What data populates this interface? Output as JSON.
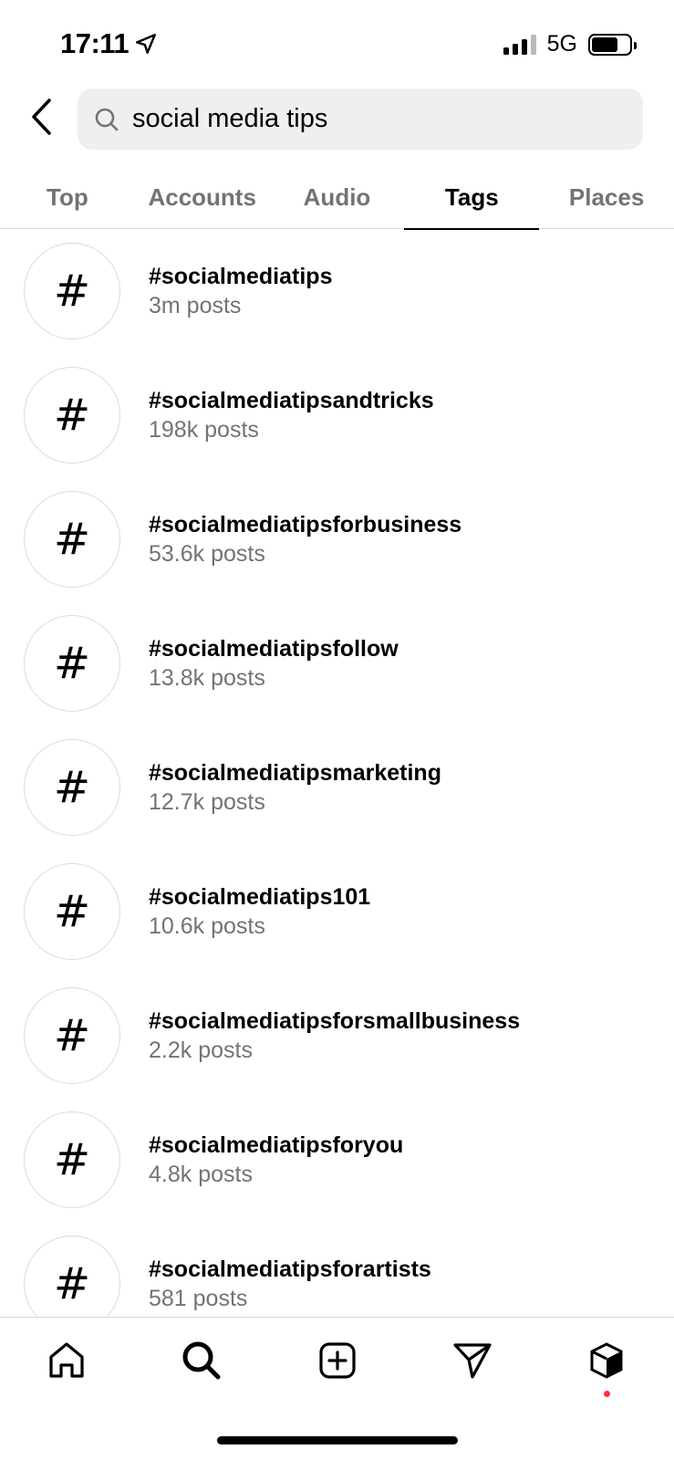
{
  "status_bar": {
    "time": "17:11",
    "network": "5G",
    "location_icon": "location-arrow-icon",
    "signal_bars_active": 3,
    "signal_bars_total": 4,
    "battery_level": 0.7
  },
  "header": {
    "back_icon": "chevron-left-icon",
    "search": {
      "icon": "search-icon",
      "value": "social media tips",
      "placeholder": "Search"
    }
  },
  "tabs": [
    {
      "label": "Top",
      "active": false
    },
    {
      "label": "Accounts",
      "active": false
    },
    {
      "label": "Audio",
      "active": false
    },
    {
      "label": "Tags",
      "active": true
    },
    {
      "label": "Places",
      "active": false
    }
  ],
  "results": [
    {
      "icon": "#",
      "name": "#socialmediatips",
      "count": "3m posts"
    },
    {
      "icon": "#",
      "name": "#socialmediatipsandtricks",
      "count": "198k posts"
    },
    {
      "icon": "#",
      "name": "#socialmediatipsforbusiness",
      "count": "53.6k posts"
    },
    {
      "icon": "#",
      "name": "#socialmediatipsfollow",
      "count": "13.8k posts"
    },
    {
      "icon": "#",
      "name": "#socialmediatipsmarketing",
      "count": "12.7k posts"
    },
    {
      "icon": "#",
      "name": "#socialmediatips101",
      "count": "10.6k posts"
    },
    {
      "icon": "#",
      "name": "#socialmediatipsforsmallbusiness",
      "count": "2.2k posts"
    },
    {
      "icon": "#",
      "name": "#socialmediatipsforyou",
      "count": "4.8k posts"
    },
    {
      "icon": "#",
      "name": "#socialmediatipsforartists",
      "count": "581 posts"
    }
  ],
  "bottom_nav": {
    "items": [
      "home-icon",
      "search-icon",
      "create-post-icon",
      "direct-message-icon",
      "profile-cube-icon"
    ],
    "active": "search-icon",
    "notification_dot_color": "#ff3040"
  }
}
